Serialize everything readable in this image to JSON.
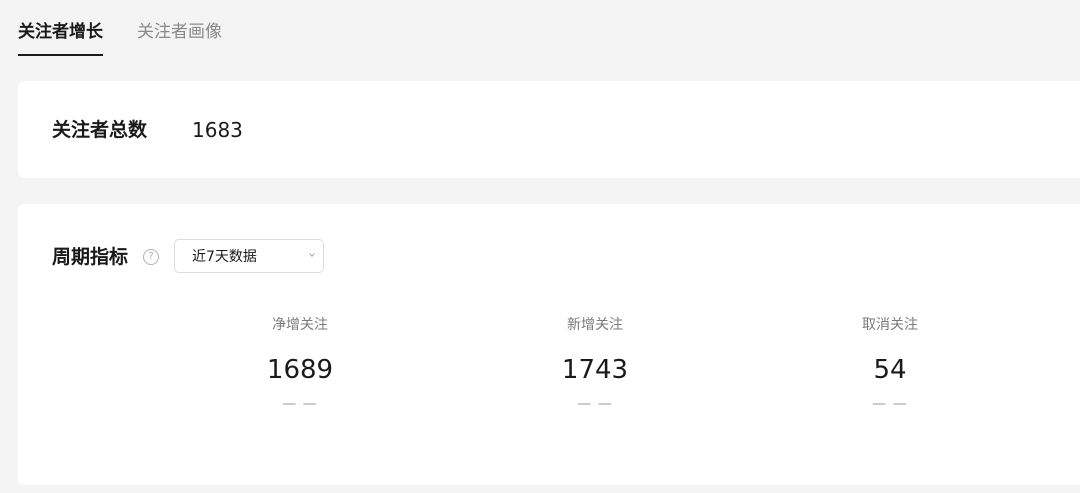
{
  "tabs": {
    "growth": "关注者增长",
    "portrait": "关注者画像"
  },
  "total": {
    "label": "关注者总数",
    "value": "1683"
  },
  "period": {
    "title": "周期指标",
    "help_icon": "question-circle-icon",
    "range_select": {
      "value": "近7天数据"
    },
    "metrics": [
      {
        "label": "净增关注",
        "value": "1689",
        "sub": "— —"
      },
      {
        "label": "新增关注",
        "value": "1743",
        "sub": "— —"
      },
      {
        "label": "取消关注",
        "value": "54",
        "sub": "— —"
      }
    ]
  }
}
